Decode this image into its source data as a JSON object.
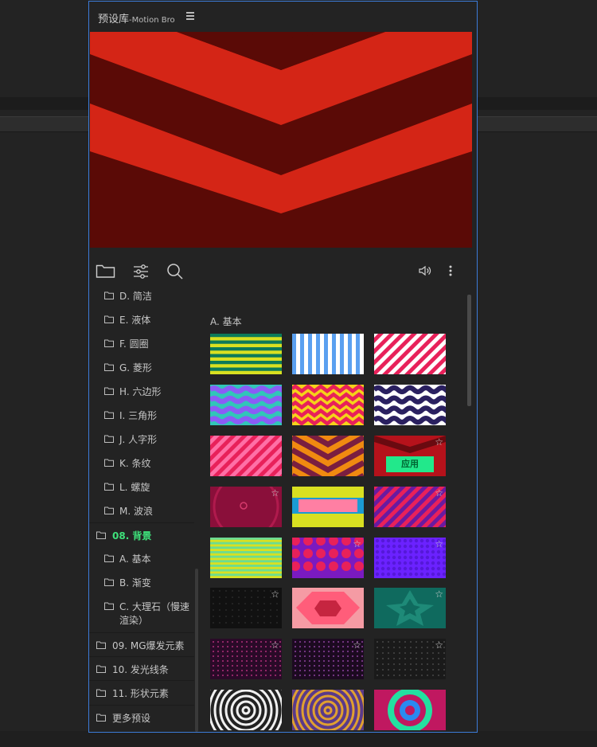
{
  "panel": {
    "title": "预设库",
    "subtitle": "-Motion Bro"
  },
  "toolbar": {
    "folder_icon": "folder-icon",
    "settings_icon": "sliders-icon",
    "search_icon": "search-icon",
    "volume_icon": "volume-icon",
    "more_icon": "more-vertical-icon"
  },
  "tree": {
    "items": [
      {
        "label": "D. 简洁",
        "level": "sub"
      },
      {
        "label": "E. 液体",
        "level": "sub"
      },
      {
        "label": "F. 圆圈",
        "level": "sub"
      },
      {
        "label": "G. 菱形",
        "level": "sub"
      },
      {
        "label": "H. 六边形",
        "level": "sub"
      },
      {
        "label": "I. 三角形",
        "level": "sub"
      },
      {
        "label": "J. 人字形",
        "level": "sub"
      },
      {
        "label": "K. 条纹",
        "level": "sub"
      },
      {
        "label": "L. 螺旋",
        "level": "sub"
      },
      {
        "label": "M. 波浪",
        "level": "sub"
      },
      {
        "label": "08. 背景",
        "level": "top",
        "active": true
      },
      {
        "label": "A. 基本",
        "level": "sub"
      },
      {
        "label": "B. 渐变",
        "level": "sub"
      },
      {
        "label": "C. 大理石（慢速",
        "label2": "渲染）",
        "level": "sub"
      },
      {
        "label": "09. MG爆发元素",
        "level": "top"
      },
      {
        "label": "10. 发光线条",
        "level": "top"
      },
      {
        "label": "11. 形状元素",
        "level": "top"
      },
      {
        "label": "更多预设",
        "level": "top"
      }
    ]
  },
  "grid": {
    "section_title": "A. 基本",
    "apply_label": "应用",
    "star_glyph": "☆"
  },
  "colors": {
    "accent_border": "#3c7bd8",
    "active_green": "#3ee07a",
    "apply_green": "#22e88b",
    "preview_red": "#d42516",
    "preview_dark": "#5a0a06"
  }
}
